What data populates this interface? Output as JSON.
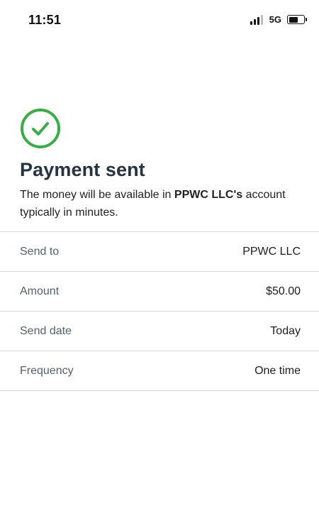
{
  "status_bar": {
    "time": "11:51",
    "network": "5G",
    "battery_level": 0.55
  },
  "header": {
    "icon": "check-circle-icon",
    "icon_color": "#3daa4a",
    "title": "Payment sent",
    "message_prefix": "The money will be available in ",
    "payee_bold": "PPWC LLC's",
    "message_suffix": " account typically in minutes."
  },
  "details": [
    {
      "label": "Send to",
      "value": "PPWC LLC"
    },
    {
      "label": "Amount",
      "value": "$50.00"
    },
    {
      "label": "Send date",
      "value": "Today"
    },
    {
      "label": "Frequency",
      "value": "One time"
    }
  ]
}
